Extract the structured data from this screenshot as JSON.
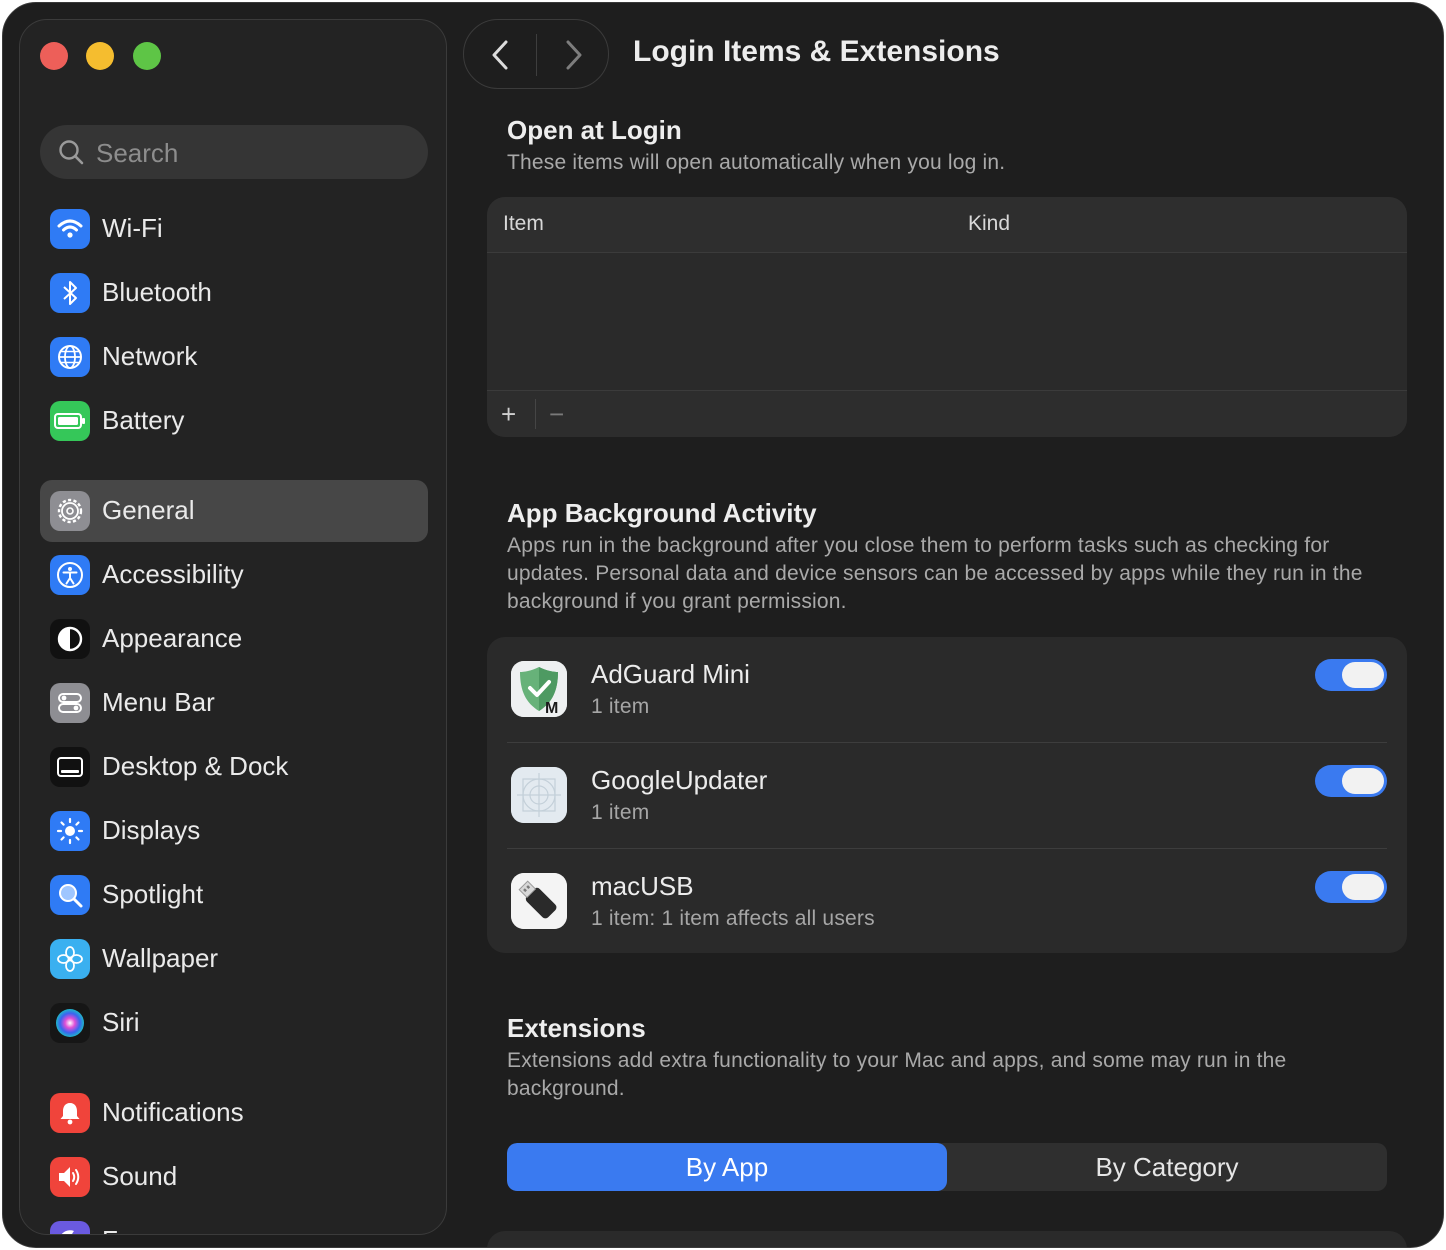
{
  "window": {
    "title": "Login Items & Extensions"
  },
  "sidebar": {
    "search": {
      "placeholder": "Search"
    },
    "items": [
      {
        "label": "Wi-Fi",
        "icon": "wifi-icon",
        "color": "#2f7bf5"
      },
      {
        "label": "Bluetooth",
        "icon": "bluetooth-icon",
        "color": "#2f7bf5"
      },
      {
        "label": "Network",
        "icon": "globe-icon",
        "color": "#2f7bf5"
      },
      {
        "label": "Battery",
        "icon": "battery-icon",
        "color": "#35c759"
      },
      {
        "label": "General",
        "icon": "gear-icon",
        "color": "#8e8e93",
        "selected": true
      },
      {
        "label": "Accessibility",
        "icon": "accessibility-icon",
        "color": "#2f7bf5"
      },
      {
        "label": "Appearance",
        "icon": "appearance-icon",
        "color": "#1a1a1a"
      },
      {
        "label": "Menu Bar",
        "icon": "menubar-icon",
        "color": "#8e8e93"
      },
      {
        "label": "Desktop & Dock",
        "icon": "dock-icon",
        "color": "#1a1a1a"
      },
      {
        "label": "Displays",
        "icon": "sun-icon",
        "color": "#2f7bf5"
      },
      {
        "label": "Spotlight",
        "icon": "magnifier-icon",
        "color": "#2f7bf5"
      },
      {
        "label": "Wallpaper",
        "icon": "flower-icon",
        "color": "#3ab0f0"
      },
      {
        "label": "Siri",
        "icon": "siri-icon",
        "color": "#6a3fd0"
      },
      {
        "label": "Notifications",
        "icon": "bell-icon",
        "color": "#f0443b"
      },
      {
        "label": "Sound",
        "icon": "speaker-icon",
        "color": "#f0443b"
      },
      {
        "label": "Focus",
        "icon": "moon-icon",
        "color": "#6a5ae0"
      }
    ]
  },
  "open_at_login": {
    "title": "Open at Login",
    "description": "These items will open automatically when you log in.",
    "columns": [
      "Item",
      "Kind"
    ],
    "add_label": "+",
    "remove_label": "−"
  },
  "background": {
    "title": "App Background Activity",
    "description": "Apps run in the background after you close them to perform tasks such as checking for updates. Personal data and device sensors can be accessed by apps while they run in the background if you grant permission.",
    "apps": [
      {
        "name": "AdGuard Mini",
        "detail": "1 item",
        "enabled": true,
        "icon": "adguard-icon"
      },
      {
        "name": "GoogleUpdater",
        "detail": "1 item",
        "enabled": true,
        "icon": "generic-app-icon"
      },
      {
        "name": "macUSB",
        "detail": "1 item: 1 item affects all users",
        "enabled": true,
        "icon": "usb-drive-icon"
      }
    ]
  },
  "extensions": {
    "title": "Extensions",
    "description": "Extensions add extra functionality to your Mac and apps, and some may run in the background.",
    "segments": [
      "By App",
      "By Category"
    ],
    "selected_segment": "By App"
  },
  "colors": {
    "accent": "#3a7af0",
    "window_bg": "#1e1e1e",
    "sidebar_bg": "#232323"
  }
}
